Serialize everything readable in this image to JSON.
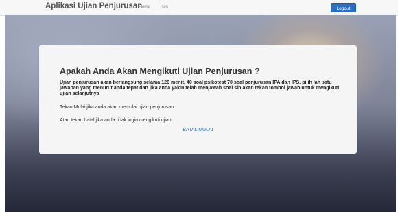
{
  "navbar": {
    "brand": "Aplikasi Ujian Penjurusan",
    "links": [
      "Home",
      "Tes"
    ],
    "logout_label": "Logout"
  },
  "card": {
    "title": "Apakah Anda Akan Mengikuti Ujian Penjurusan ?",
    "description": "Ujian penjurusan akan berlangsung selama 120 menit, 40 soal psikotest 70 soal penjurusan IPA dan IPS. pilih lah satu jawaban yang menurut anda tepat dan jika anda yakin telah menjawab soal sihlakan tekan tombol jawab untuk mengikuti ujian selanjutnya",
    "start_instruction": "Tekan Mulai jika anda akan memulai ujian penjurusan",
    "cancel_instruction": "Atau tekan batal jika anda tidak ingin mengikuti ujian",
    "cancel_start_link": "BATAL MULAI"
  },
  "colors": {
    "accent": "#2a6fc4",
    "navbar_bg": "#f7f7f7",
    "card_bg": "#f5f5f5"
  }
}
